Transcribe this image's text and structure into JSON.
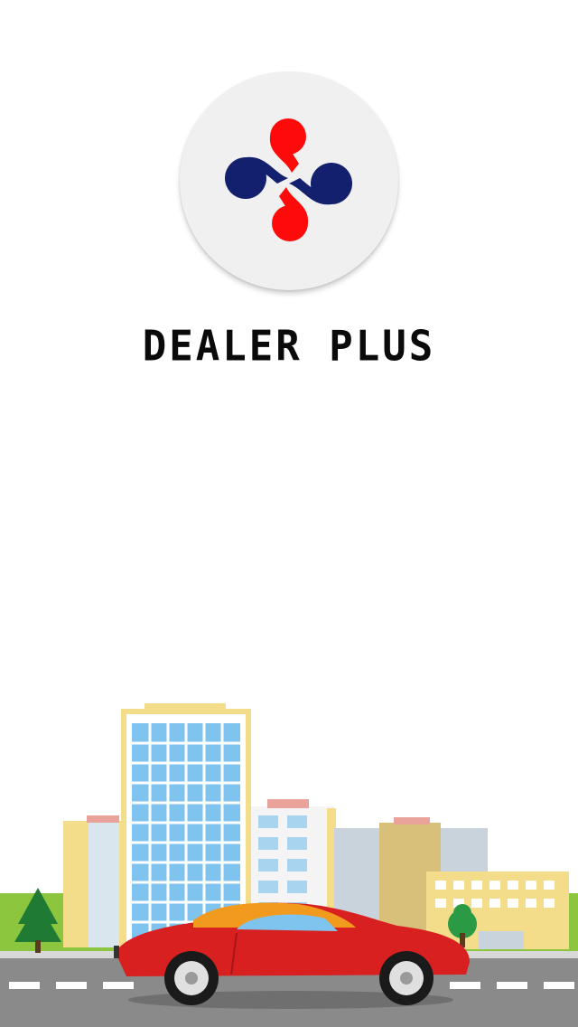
{
  "app": {
    "name": "DEALER PLUS"
  },
  "logo": {
    "icon": "dealer-plus-logo-icon",
    "colors": {
      "red": "#ff0a0a",
      "navy": "#12206e",
      "background": "#f0f0f0"
    }
  },
  "illustration": {
    "icon": "city-car-illustration",
    "colors": {
      "grass": "#8cc63f",
      "road": "#8a8a8a",
      "car": "#d92020",
      "sky_building": "#7fc4ee"
    }
  }
}
